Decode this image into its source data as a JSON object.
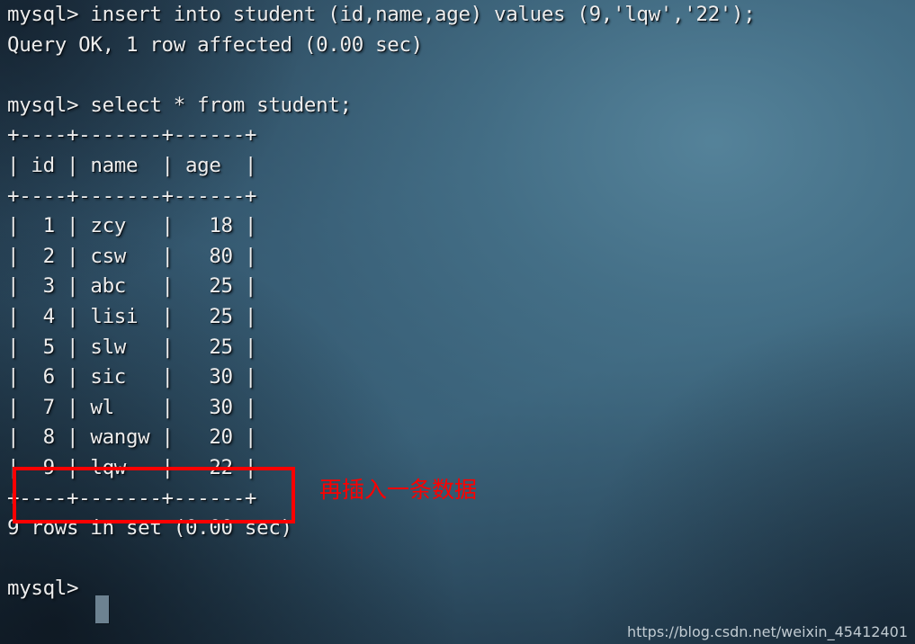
{
  "terminal": {
    "app": "mysql-client-terminal",
    "prompt": "mysql>",
    "background_color": "#3d6379",
    "background_dark_color": "#1b2c3c",
    "text_color": "#ededed",
    "cursor_color": "#6d8291",
    "lines": [
      "mysql> insert into student (id,name,age) values (9,'lqw','22');",
      "Query OK, 1 row affected (0.00 sec)",
      "",
      "mysql> select * from student;",
      "+----+-------+------+",
      "| id | name  | age  |",
      "+----+-------+------+",
      "|  1 | zcy   |   18 |",
      "|  2 | csw   |   80 |",
      "|  3 | abc   |   25 |",
      "|  4 | lisi  |   25 |",
      "|  5 | slw   |   25 |",
      "|  6 | sic   |   30 |",
      "|  7 | wl    |   30 |",
      "|  8 | wangw |   20 |",
      "|  9 | lqw   |   22 |",
      "+----+-------+------+",
      "9 rows in set (0.00 sec)",
      "",
      "mysql> "
    ],
    "body_text": "mysql> insert into student (id,name,age) values (9,'lqw','22');\nQuery OK, 1 row affected (0.00 sec)\n\nmysql> select * from student;\n+----+-------+------+\n| id | name  | age  |\n+----+-------+------+\n|  1 | zcy   |   18 |\n|  2 | csw   |   80 |\n|  3 | abc   |   25 |\n|  4 | lisi  |   25 |\n|  5 | slw   |   25 |\n|  6 | sic   |   30 |\n|  7 | wl    |   30 |\n|  8 | wangw |   20 |\n|  9 | lqw   |   22 |\n+----+-------+------+\n9 rows in set (0.00 sec)\n\nmysql> "
  },
  "commands": {
    "insert_statement": "insert into student (id,name,age) values (9,'lqw','22');",
    "insert_result": "Query OK, 1 row affected (0.00 sec)",
    "select_statement": "select * from student;",
    "select_result": "9 rows in set (0.00 sec)"
  },
  "result_table": {
    "name": "student",
    "border_line": "+----+-------+------+",
    "columns": [
      "id",
      "name",
      "age"
    ],
    "rows": [
      {
        "id": "1",
        "name": "zcy",
        "age": "18"
      },
      {
        "id": "2",
        "name": "csw",
        "age": "80"
      },
      {
        "id": "3",
        "name": "abc",
        "age": "25"
      },
      {
        "id": "4",
        "name": "lisi",
        "age": "25"
      },
      {
        "id": "5",
        "name": "slw",
        "age": "25"
      },
      {
        "id": "6",
        "name": "sic",
        "age": "30"
      },
      {
        "id": "7",
        "name": "wl",
        "age": "30"
      },
      {
        "id": "8",
        "name": "wangw",
        "age": "20"
      },
      {
        "id": "9",
        "name": "lqw",
        "age": "22"
      }
    ],
    "row_count": 9
  },
  "annotation": {
    "note_text": "再插入一条数据",
    "color": "#fe0000",
    "highlight_target": "row-id-9"
  },
  "watermark": {
    "text": "https://blog.csdn.net/weixin_45412401"
  }
}
